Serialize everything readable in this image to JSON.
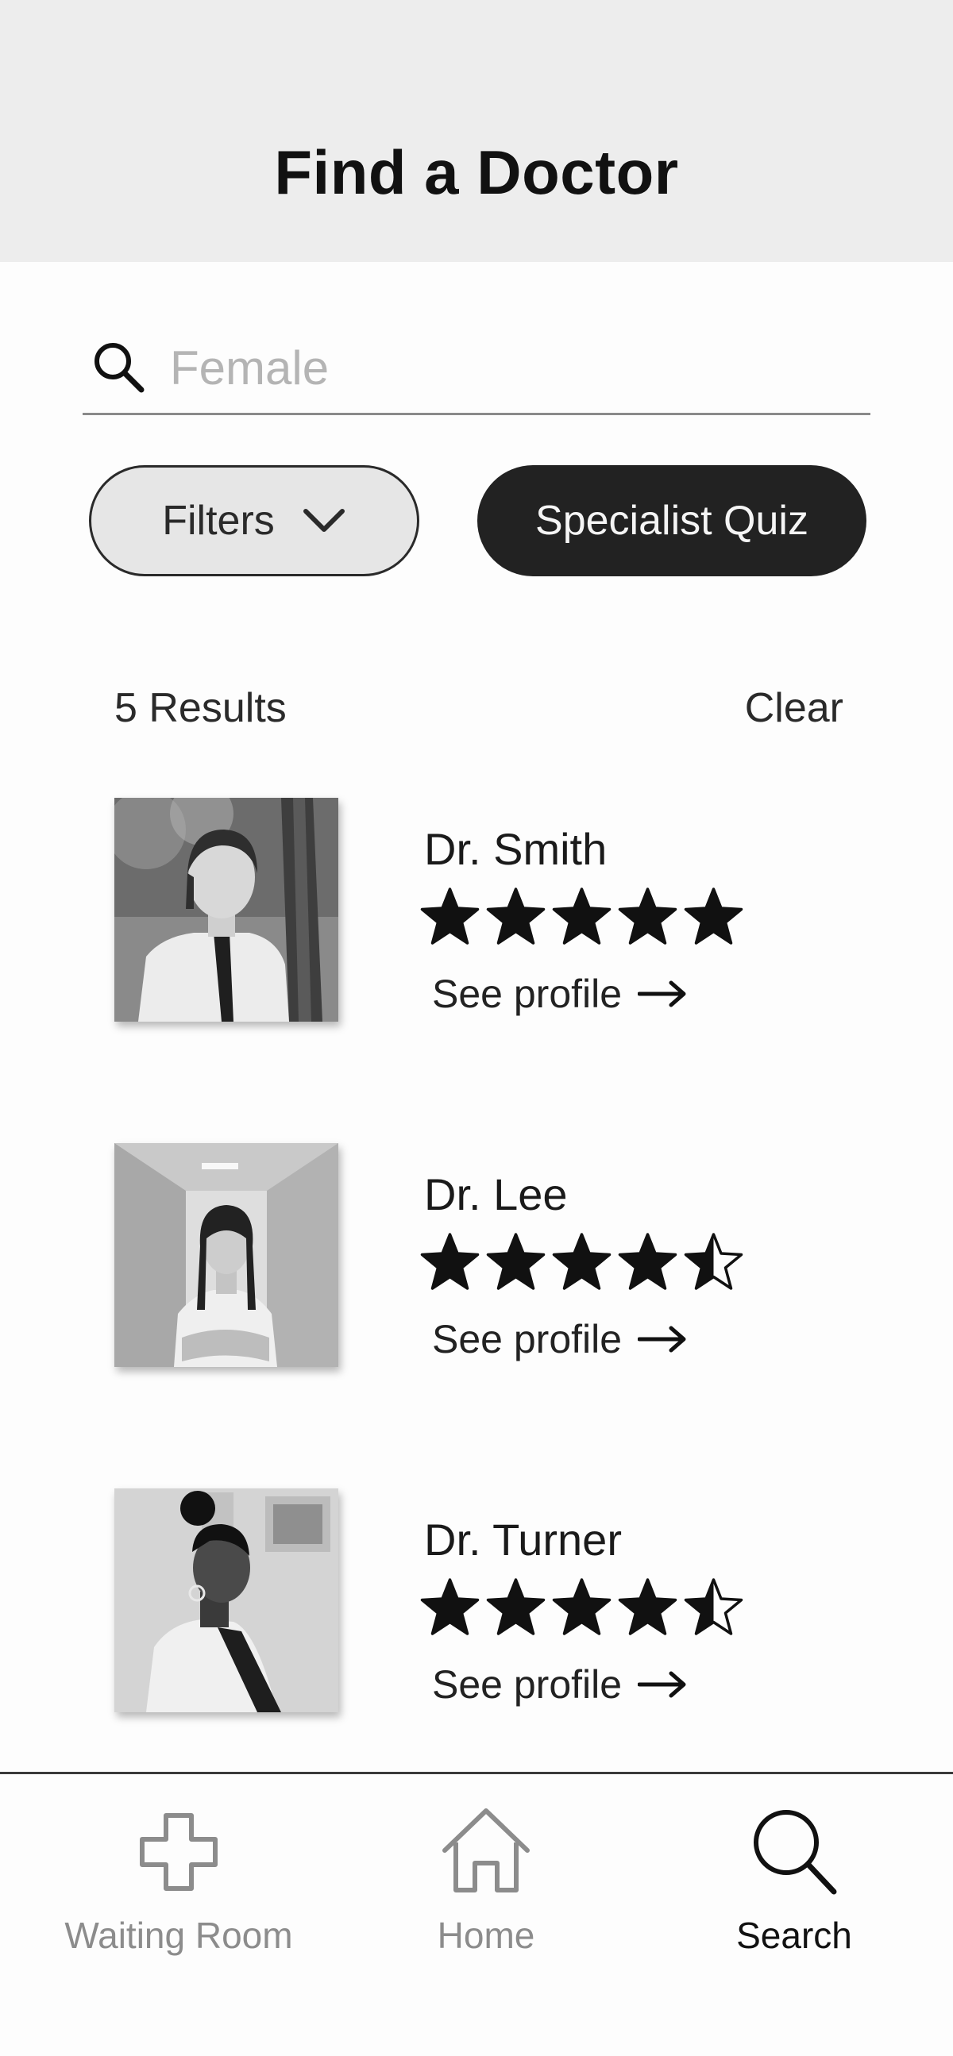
{
  "header": {
    "title": "Find a Doctor"
  },
  "search": {
    "value": "",
    "placeholder": "Female",
    "icon": "search-icon"
  },
  "filters": {
    "label": "Filters",
    "icon": "chevron-down-icon"
  },
  "quiz": {
    "label": "Specialist Quiz"
  },
  "results": {
    "count_label": "5 Results",
    "clear_label": "Clear"
  },
  "doctors": [
    {
      "name": "Dr. Smith",
      "rating": 5,
      "link_label": "See profile"
    },
    {
      "name": "Dr. Lee",
      "rating": 4.5,
      "link_label": "See profile"
    },
    {
      "name": "Dr. Turner",
      "rating": 4.5,
      "link_label": "See profile"
    }
  ],
  "nav": {
    "items": [
      {
        "label": "Waiting Room",
        "icon": "medical-cross-icon",
        "active": false
      },
      {
        "label": "Home",
        "icon": "home-icon",
        "active": false
      },
      {
        "label": "Search",
        "icon": "search-icon",
        "active": true
      }
    ]
  },
  "colors": {
    "header_bg": "#ededed",
    "quiz_bg": "#222222",
    "filters_bg": "#e6e6e6",
    "nav_inactive": "#8c8c8c",
    "nav_active": "#111111"
  }
}
